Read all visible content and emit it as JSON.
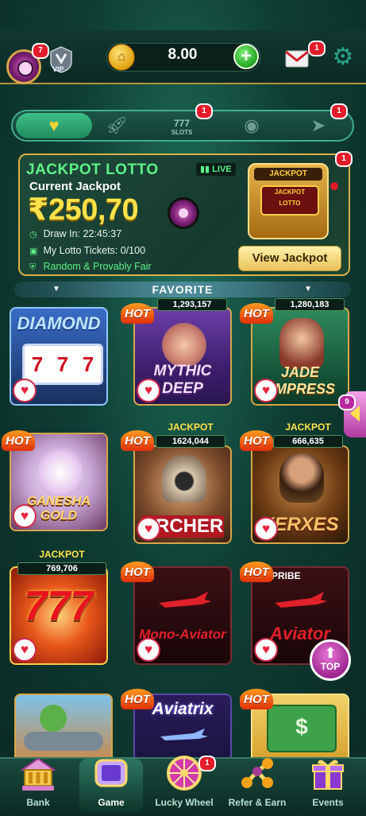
{
  "header": {
    "avatar_badge": "7",
    "vip_label": "VIP",
    "balance": "8.00",
    "mail_badge": "1"
  },
  "tabs": {
    "items": [
      {
        "name": "favorite-tab",
        "icon": "heart-icon"
      },
      {
        "name": "rocket-tab",
        "icon": "rocket-icon"
      },
      {
        "name": "slots-tab",
        "top": "777",
        "label": "SLOTS",
        "badge": "1"
      },
      {
        "name": "table-tab",
        "icon": "roulette-icon"
      },
      {
        "name": "shark-tab",
        "icon": "shark-icon",
        "badge": "1"
      }
    ]
  },
  "jackpot_lotto": {
    "title": "JACKPOT LOTTO",
    "live": "LIVE",
    "subtitle": "Current Jackpot",
    "amount": "₹250,70",
    "draw_in": "Draw In: 22:45:37",
    "tickets": "My Lotto Tickets: 0/100",
    "fair": "Random & Provably Fair",
    "machine_header": "JACKPOT",
    "machine_screen_1": "JACKPOT",
    "machine_screen_2": "LOTTO",
    "button": "View Jackpot",
    "badge": "1"
  },
  "favorite": {
    "label": "FAVORITE"
  },
  "games": {
    "hot": "HOT",
    "jackpot": "JACKPOT",
    "diamond": {
      "title": "DIAMOND"
    },
    "mythic": {
      "title": "MYTHIC DEEP",
      "value": "1,293,157"
    },
    "jade": {
      "title": "JADE EMPRESS",
      "value": "1,280,183"
    },
    "ganesha": {
      "title": "GANESHA GOLD"
    },
    "archer": {
      "title": "ARCHER",
      "value": "1624,044"
    },
    "xerxes": {
      "title": "XERXES",
      "value": "666,635"
    },
    "sevens": {
      "title": "777",
      "value": "769,706"
    },
    "mono": {
      "title": "Mono-Aviator"
    },
    "aviator": {
      "title": "Aviator",
      "tag": "SPRIBE"
    },
    "aviatrix": {
      "title": "Aviatrix"
    }
  },
  "side_badge": "9",
  "top_button": "TOP",
  "nav": {
    "items": [
      {
        "label": "Bank"
      },
      {
        "label": "Game"
      },
      {
        "label": "Lucky Wheel",
        "badge": "1"
      },
      {
        "label": "Refer & Earn"
      },
      {
        "label": "Events"
      }
    ]
  }
}
